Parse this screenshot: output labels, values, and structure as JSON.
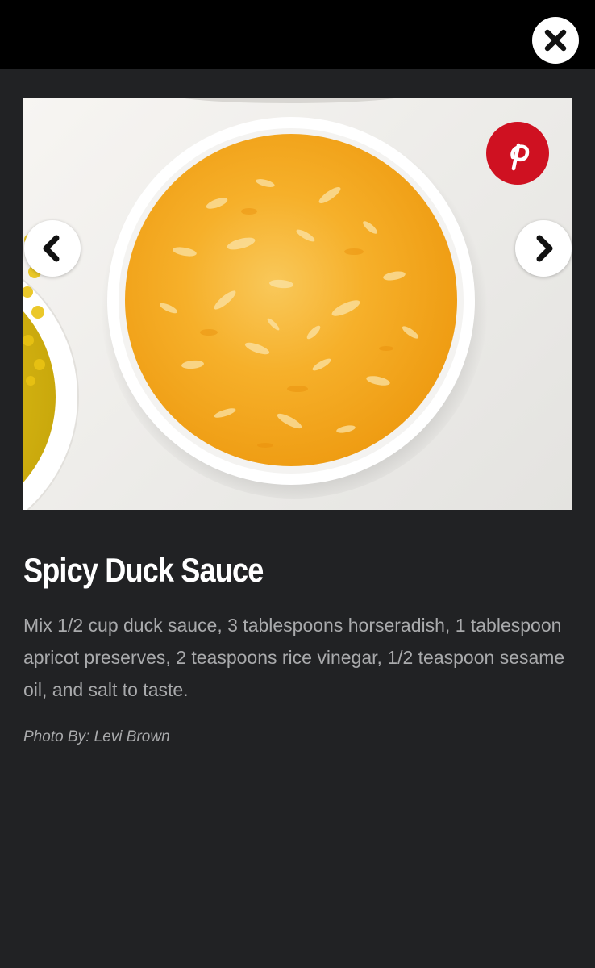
{
  "colors": {
    "background": "#212224",
    "top_bar": "#000000",
    "title": "#ffffff",
    "body_text": "#a9aaac",
    "pinterest_red": "#cf1121",
    "sauce": "#f5ac1c"
  },
  "top_bar": {
    "close_icon": "close-icon"
  },
  "slideshow": {
    "prev_icon": "chevron-left-icon",
    "next_icon": "chevron-right-icon",
    "share_icon": "pinterest-icon"
  },
  "slide": {
    "title": "Spicy Duck Sauce",
    "description": "Mix 1/2 cup duck sauce, 3 tablespoons horseradish, 1 tablespoon apricot preserves, 2 teaspoons rice vinegar, 1/2 teaspoon sesame oil, and salt to taste.",
    "credit": "Photo By: Levi Brown"
  }
}
